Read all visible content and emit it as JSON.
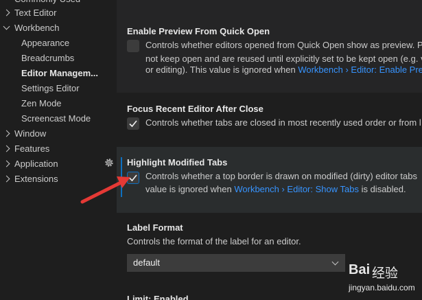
{
  "sidebar": {
    "items": [
      {
        "label": "Commonly Used"
      },
      {
        "label": "Text Editor"
      },
      {
        "label": "Workbench"
      },
      {
        "label": "Appearance"
      },
      {
        "label": "Breadcrumbs"
      },
      {
        "label": "Editor Managem..."
      },
      {
        "label": "Settings Editor"
      },
      {
        "label": "Zen Mode"
      },
      {
        "label": "Screencast Mode"
      },
      {
        "label": "Window"
      },
      {
        "label": "Features"
      },
      {
        "label": "Application"
      },
      {
        "label": "Extensions"
      }
    ]
  },
  "settings": {
    "preview_quick_open": {
      "title": "Enable Preview From Quick Open",
      "checked": false,
      "desc1": "Controls whether editors opened from Quick Open show as preview. P",
      "desc2": "not keep open and are reused until explicitly set to be kept open (e.g. v",
      "desc3_pre": "or editing). This value is ignored when ",
      "desc3_link": "Workbench › Editor: Enable Previ"
    },
    "focus_recent": {
      "title": "Focus Recent Editor After Close",
      "checked": true,
      "desc1": "Controls whether tabs are closed in most recently used order or from l"
    },
    "highlight_modified": {
      "title": "Highlight Modified Tabs",
      "checked": true,
      "desc1": "Controls whether a top border is drawn on modified (dirty) editor tabs",
      "desc2_pre": "value is ignored when ",
      "desc2_link": "Workbench › Editor: Show Tabs",
      "desc2_post": " is disabled."
    },
    "label_format": {
      "title": "Label Format",
      "desc1": "Controls the format of the label for an editor.",
      "value": "default"
    },
    "limit": {
      "title": "Limit: Enabled"
    }
  },
  "watermark": {
    "brand": "Bai",
    "text": "经验",
    "url": "jingyan.baidu.com"
  },
  "colors": {
    "accent": "#3794ff",
    "focus_border": "#0e70c0",
    "annotation_arrow": "#e53935"
  }
}
